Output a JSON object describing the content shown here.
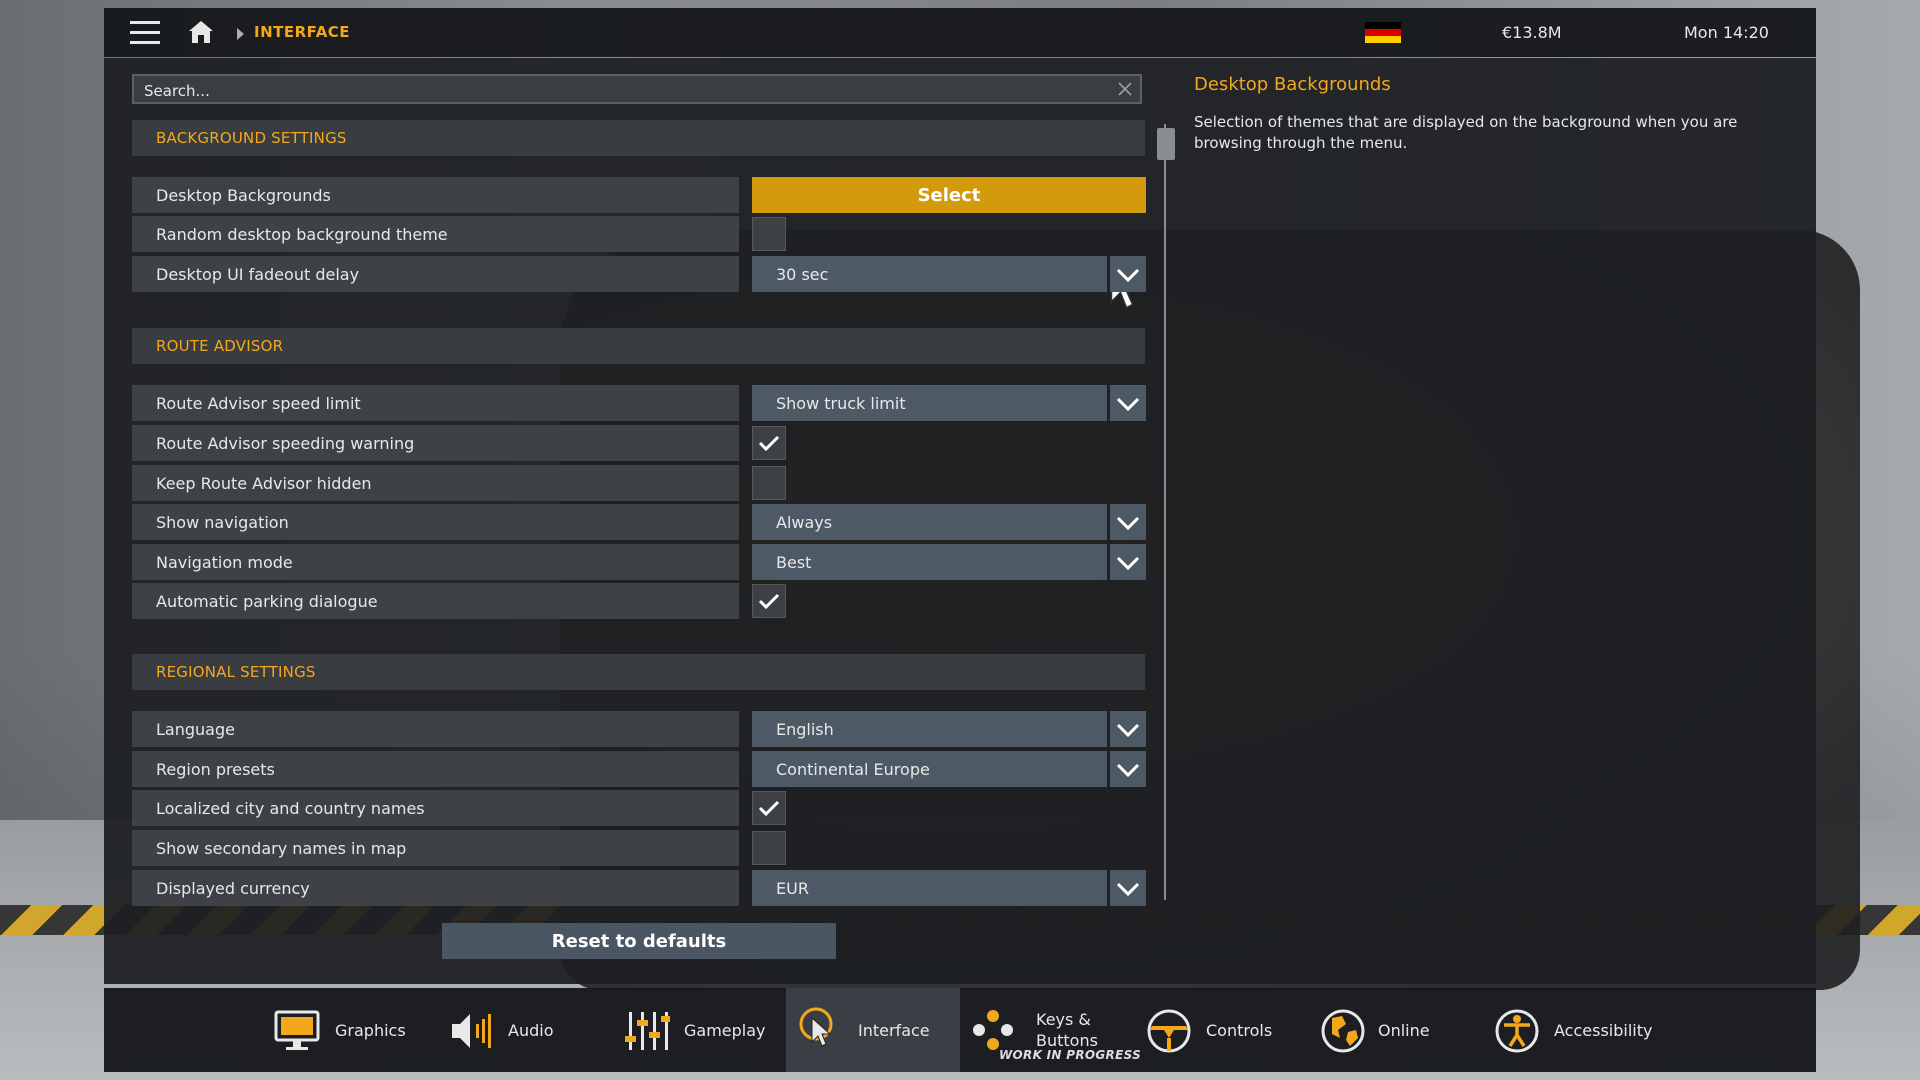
{
  "header": {
    "breadcrumb": "INTERFACE",
    "money": "€13.8M",
    "clock": "Mon 14:20",
    "flag_colors": [
      "#000000",
      "#dd0000",
      "#ffce00"
    ]
  },
  "search": {
    "placeholder": "Search..."
  },
  "sections": {
    "background": {
      "title": "BACKGROUND SETTINGS",
      "desktop_backgrounds": {
        "label": "Desktop Backgrounds",
        "button": "Select"
      },
      "random_theme": {
        "label": "Random desktop background theme",
        "checked": false
      },
      "fadeout_delay": {
        "label": "Desktop UI fadeout delay",
        "value": "30 sec"
      }
    },
    "route": {
      "title": "ROUTE ADVISOR",
      "speed_limit": {
        "label": "Route Advisor speed limit",
        "value": "Show truck limit"
      },
      "speeding_warning": {
        "label": "Route Advisor speeding warning",
        "checked": true
      },
      "keep_hidden": {
        "label": "Keep Route Advisor hidden",
        "checked": false
      },
      "show_navigation": {
        "label": "Show navigation",
        "value": "Always"
      },
      "navigation_mode": {
        "label": "Navigation mode",
        "value": "Best"
      },
      "parking_dialogue": {
        "label": "Automatic parking dialogue",
        "checked": true
      }
    },
    "regional": {
      "title": "REGIONAL SETTINGS",
      "language": {
        "label": "Language",
        "value": "English"
      },
      "region_presets": {
        "label": "Region presets",
        "value": "Continental Europe"
      },
      "localized_names": {
        "label": "Localized city and country names",
        "checked": true
      },
      "secondary_names": {
        "label": "Show secondary names in map",
        "checked": false
      },
      "currency": {
        "label": "Displayed currency",
        "value": "EUR"
      }
    }
  },
  "reset_label": "Reset to defaults",
  "description": {
    "title": "Desktop Backgrounds",
    "text": "Selection of themes that are displayed on the background when you are browsing through the menu."
  },
  "tabs": {
    "graphics": "Graphics",
    "audio": "Audio",
    "gameplay": "Gameplay",
    "interface": "Interface",
    "keys_line1": "Keys &",
    "keys_line2": "Buttons",
    "controls": "Controls",
    "online": "Online",
    "accessibility": "Accessibility",
    "wip": "WORK IN PROGRESS"
  },
  "colors": {
    "accent": "#f3a81c",
    "select_button": "#d39a0c",
    "dropdown": "#4d5a66"
  }
}
